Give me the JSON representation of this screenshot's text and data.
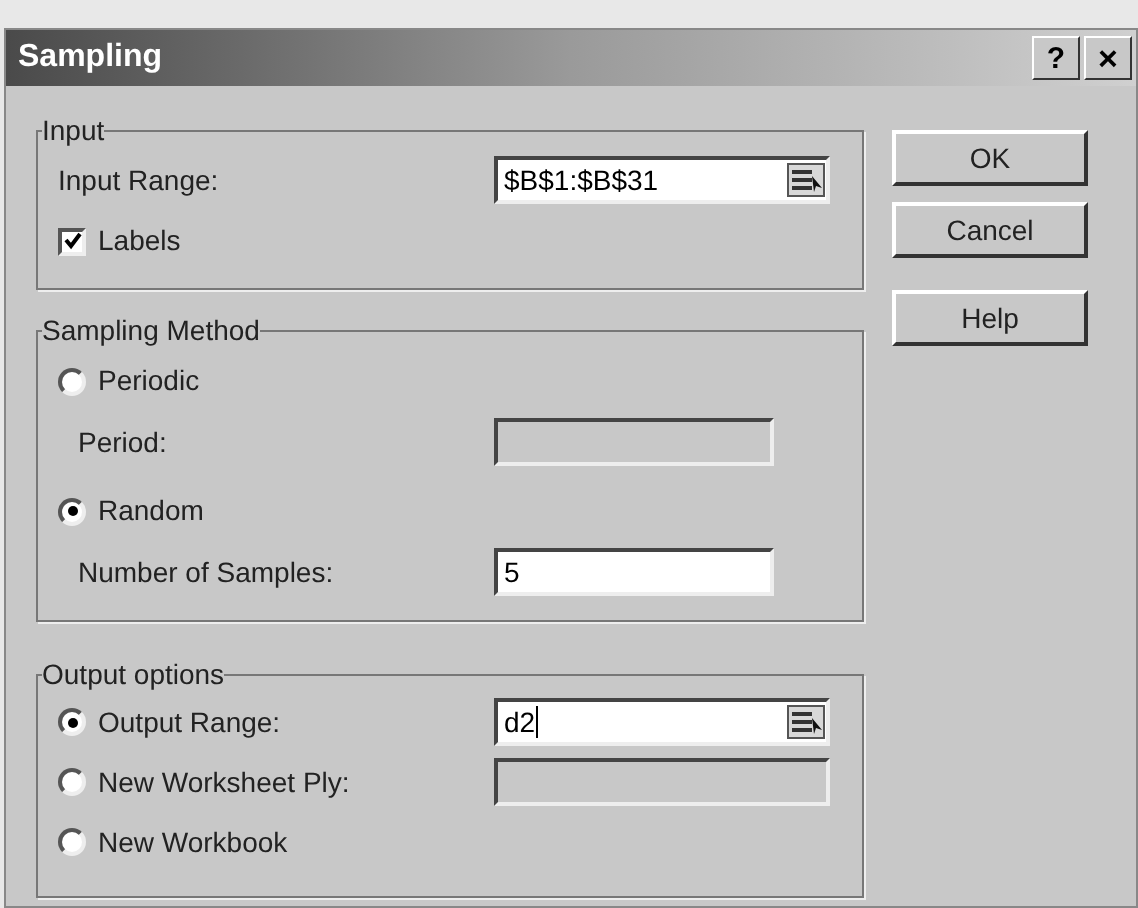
{
  "window": {
    "title": "Sampling",
    "help_button": "?",
    "close_button": "×"
  },
  "input": {
    "title": "Input",
    "range": {
      "label": "Input Range:",
      "value": "$B$1:$B$31",
      "kind": "ref"
    },
    "labels_checkbox": {
      "label": "Labels",
      "checked": true
    }
  },
  "sampling_method": {
    "title": "Sampling Method",
    "options": [
      {
        "label": "Periodic",
        "selected": false,
        "field": {
          "label": "Period:",
          "kind": "plain",
          "disabled": true
        }
      },
      {
        "label": "Random",
        "selected": true,
        "field": {
          "label": "Number of Samples:",
          "value": "5",
          "kind": "plain",
          "disabled": false
        }
      }
    ]
  },
  "output_options": {
    "title": "Output options",
    "options": [
      {
        "label": "Output Range:",
        "selected": true,
        "field": {
          "value": "d2",
          "kind": "ref",
          "disabled": false,
          "caret": true
        }
      },
      {
        "label": "New Worksheet Ply:",
        "selected": false,
        "field": {
          "kind": "ref_blank",
          "disabled": true
        }
      },
      {
        "label": "New Workbook",
        "selected": false
      }
    ]
  },
  "buttons": [
    {
      "label": "OK"
    },
    {
      "label": "Cancel"
    },
    {
      "label": "Help"
    }
  ]
}
